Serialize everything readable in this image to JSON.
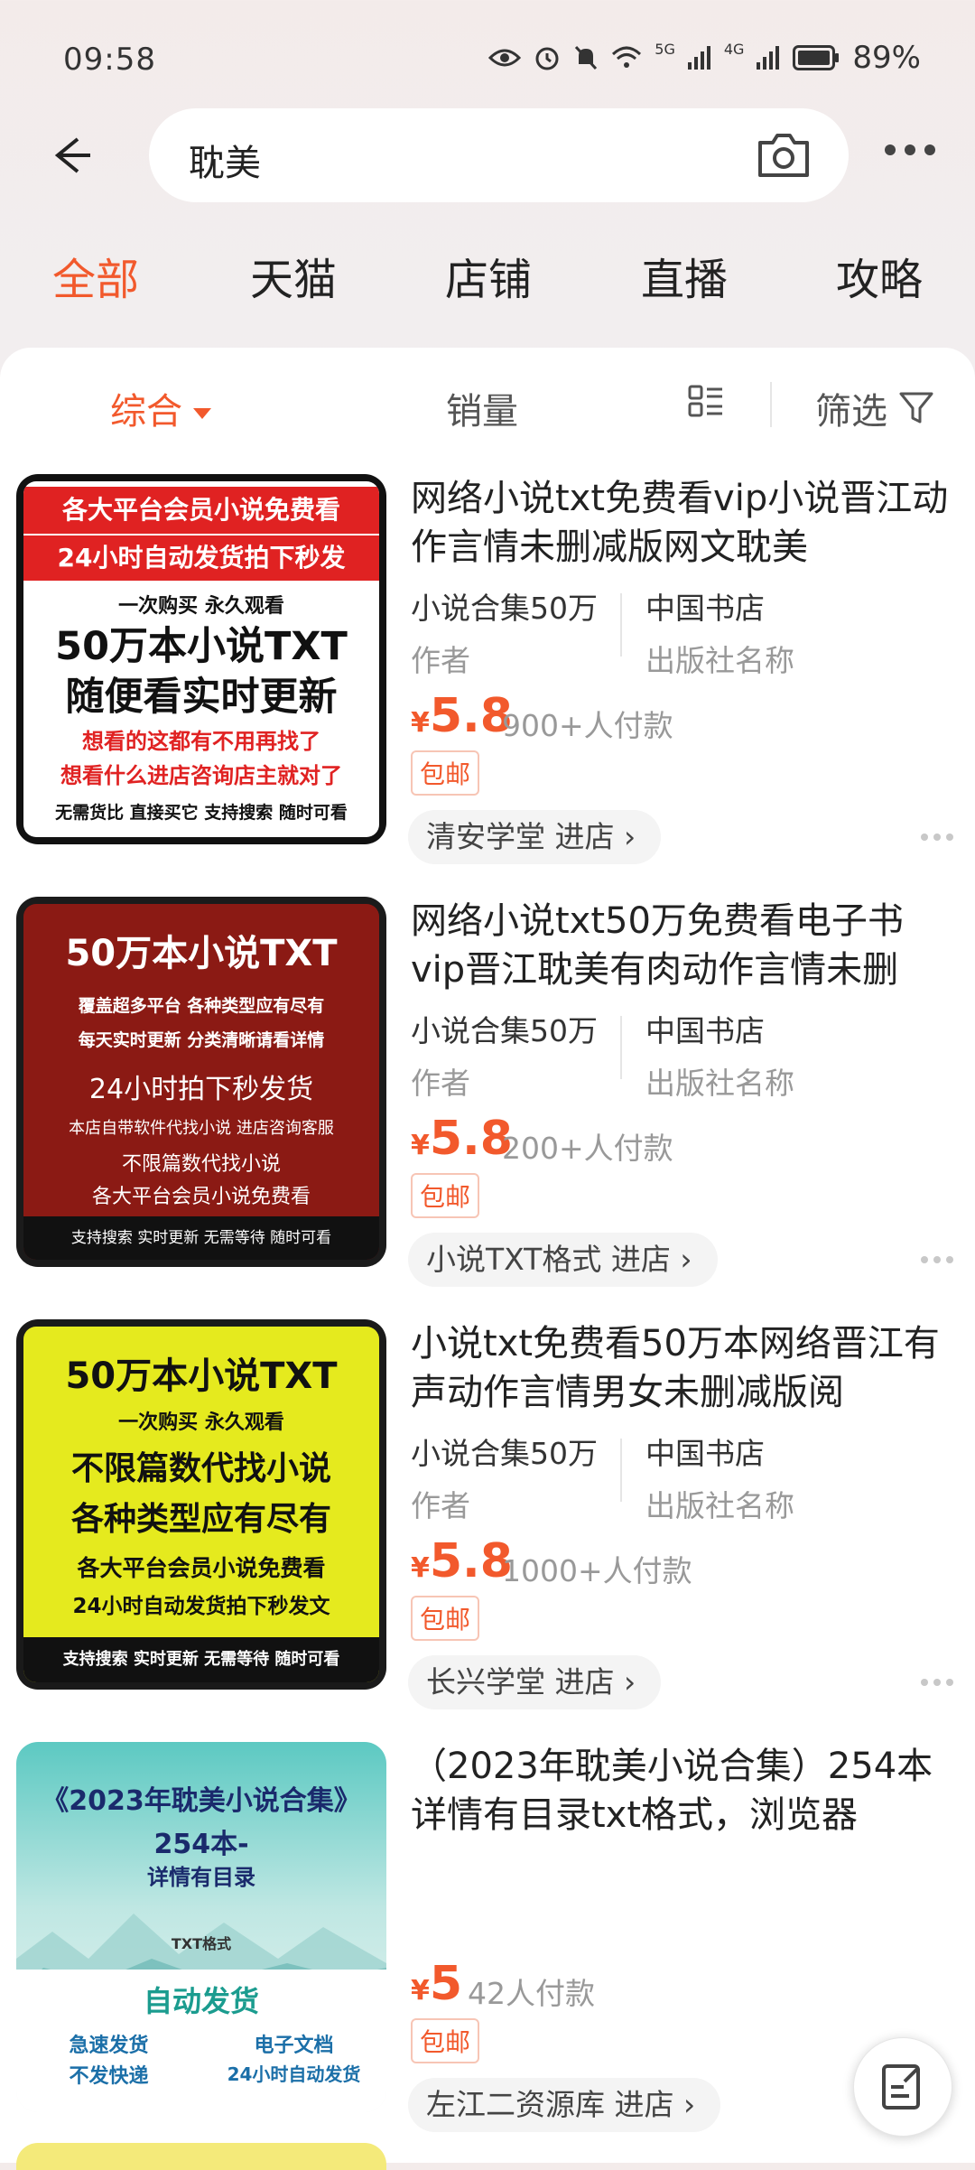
{
  "status": {
    "time": "09:58",
    "battery": "89%",
    "net1": "5G",
    "net2": "4G"
  },
  "search": {
    "query": "耽美"
  },
  "tabs": [
    "全部",
    "天猫",
    "店铺",
    "直播",
    "攻略"
  ],
  "sort": {
    "comprehensive": "综合",
    "sales": "销量",
    "filter": "筛选"
  },
  "colors": {
    "accent": "#f2592c"
  },
  "items": [
    {
      "title": "网络小说txt免费看vip小说晋江动作言情未删减版网文耽美",
      "attr1_value": "小说合集50万",
      "attr1_key": "作者",
      "attr2_value": "中国书店",
      "attr2_key": "出版社名称",
      "price_symbol": "¥",
      "price": "5.8",
      "sold": "900+人付款",
      "badge": "包邮",
      "shop": "清安学堂 进店 ›",
      "thumb": [
        "各大平台会员小说免费看",
        "24小时自动发货拍下秒发",
        "一次购买    永久观看",
        "50万本小说TXT",
        "随便看实时更新",
        "想看的这都有不用再找了",
        "想看什么进店咨询店主就对了",
        "无需货比  直接买它  支持搜索  随时可看"
      ]
    },
    {
      "title": "网络小说txt50万免费看电子书vip晋江耽美有肉动作言情未删",
      "attr1_value": "小说合集50万",
      "attr1_key": "作者",
      "attr2_value": "中国书店",
      "attr2_key": "出版社名称",
      "price_symbol": "¥",
      "price": "5.8",
      "sold": "200+人付款",
      "badge": "包邮",
      "shop": "小说TXT格式 进店 ›",
      "thumb": [
        "50万本小说TXT",
        "覆盖超多平台      各种类型应有尽有",
        "每天实时更新      分类清晰请看详情",
        "24小时拍下秒发货",
        "本店自带软件代找小说  进店咨询客服",
        "不限篇数代找小说",
        "各大平台会员小说免费看",
        "支持搜索  实时更新  无需等待  随时可看"
      ]
    },
    {
      "title": "小说txt免费看50万本网络晋江有声动作言情男女未删减版阅",
      "attr1_value": "小说合集50万",
      "attr1_key": "作者",
      "attr2_value": "中国书店",
      "attr2_key": "出版社名称",
      "price_symbol": "¥",
      "price": "5.8",
      "sold": "1000+人付款",
      "badge": "包邮",
      "shop": "长兴学堂 进店 ›",
      "thumb": [
        "50万本小说TXT",
        "一次购买    永久观看",
        "不限篇数代找小说",
        "各种类型应有尽有",
        "各大平台会员小说免费看",
        "24小时自动发货拍下秒发文",
        "支持搜索 实时更新 无需等待 随时可看"
      ]
    },
    {
      "title": "（2023年耽美小说合集）254本详情有目录txt格式，浏览器",
      "price_symbol": "¥",
      "price": "5",
      "sold": "42人付款",
      "badge": "包邮",
      "shop": "左江二资源库 进店 ›",
      "thumb": [
        "《2023年耽美小说合集》",
        "254本-",
        "详情有目录",
        "TXT格式",
        "自动发货",
        "急速发货",
        "电子文档",
        "不发快递",
        "24小时自动发货"
      ]
    }
  ]
}
